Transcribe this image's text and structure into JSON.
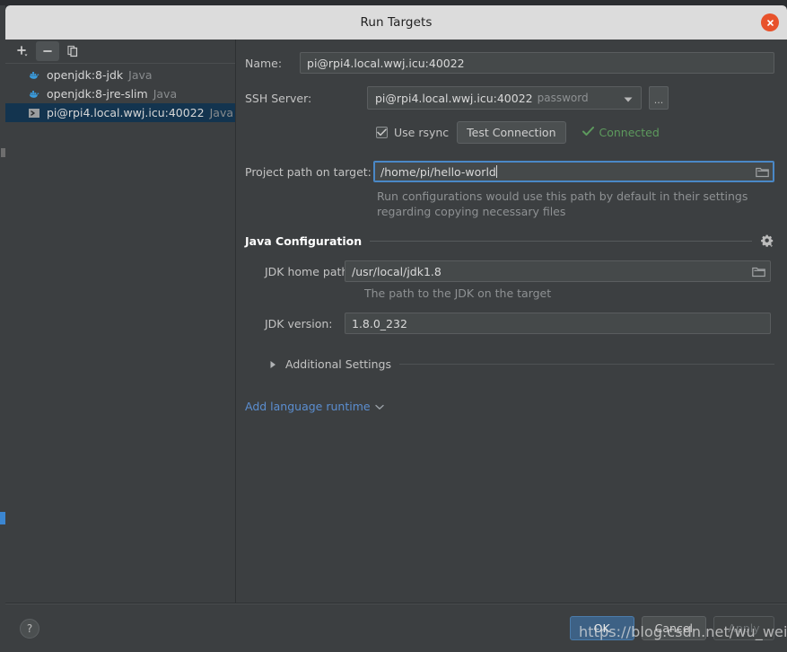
{
  "window": {
    "title": "Run Targets",
    "close_icon": "close-icon"
  },
  "sidebar": {
    "toolbar": [
      {
        "name": "add-target-button",
        "icon": "plus-dropdown-icon",
        "label": "+"
      },
      {
        "name": "remove-target-button",
        "icon": "minus-icon",
        "label": "−"
      },
      {
        "name": "copy-target-button",
        "icon": "copy-icon",
        "label": "Copy"
      }
    ],
    "items": [
      {
        "label": "openjdk:8-jdk",
        "lang": "Java",
        "icon": "docker-icon",
        "selected": false
      },
      {
        "label": "openjdk:8-jre-slim",
        "lang": "Java",
        "icon": "docker-icon",
        "selected": false
      },
      {
        "label": "pi@rpi4.local.wwj.icu:40022",
        "lang": "Java",
        "icon": "terminal-icon",
        "selected": true
      }
    ]
  },
  "form": {
    "name_label": "Name:",
    "name_value": "pi@rpi4.local.wwj.icu:40022",
    "ssh_label": "SSH Server:",
    "ssh_value": "pi@rpi4.local.wwj.icu:40022",
    "ssh_auth": "password",
    "ssh_ellipsis_label": "...",
    "rsync_label": "Use rsync",
    "rsync_checked": true,
    "test_connection_label": "Test Connection",
    "connection_status": "Connected",
    "connection_status_color": "#5d9a5d",
    "projpath_label": "Project path on target:",
    "projpath_value": "/home/pi/hello-world",
    "projpath_hint": "Run configurations would use this path by default in their settings regarding copying necessary files",
    "browse_icon": "folder-icon"
  },
  "java_section": {
    "title": "Java Configuration",
    "gear_icon": "gear-dropdown-icon",
    "jdk_home_label": "JDK home path:",
    "jdk_home_value": "/usr/local/jdk1.8",
    "jdk_home_hint": "The path to the JDK on the target",
    "jdk_version_label": "JDK version:",
    "jdk_version_value": "1.8.0_232"
  },
  "additional_settings": {
    "label": "Additional Settings",
    "expanded": false,
    "icon": "triangle-right-icon"
  },
  "add_runtime": {
    "label": "Add language runtime",
    "icon": "chevron-down-icon",
    "color": "#5b8ed0"
  },
  "footer": {
    "help_label": "?",
    "help_icon": "question-icon",
    "buttons": [
      {
        "label": "OK",
        "style": "primary"
      },
      {
        "label": "Cancel",
        "style": "normal"
      },
      {
        "label": "Apply",
        "style": "disabled"
      }
    ]
  },
  "watermark": {
    "text": "https://blog.csdn.net/wu_weijie"
  }
}
